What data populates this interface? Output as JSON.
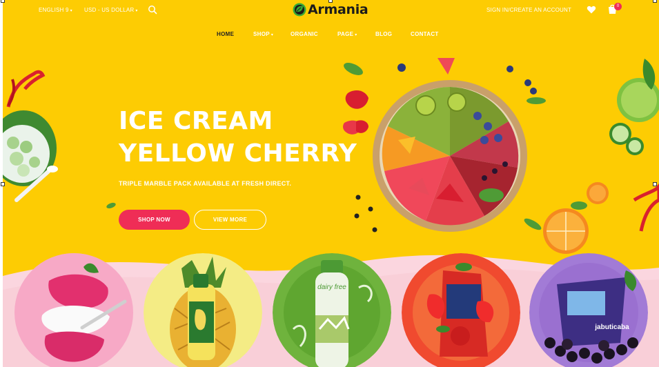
{
  "topbar": {
    "language": "ENGLISH 9",
    "currency": "USD - US DOLLAR",
    "account": "SIGN IN/CREATE AN ACCOUNT",
    "cart_count": "0"
  },
  "logo": {
    "text": "Armania"
  },
  "nav": {
    "items": [
      {
        "label": "HOME",
        "active": true,
        "has_caret": false
      },
      {
        "label": "SHOP",
        "active": false,
        "has_caret": true
      },
      {
        "label": "ORGANIC",
        "active": false,
        "has_caret": false
      },
      {
        "label": "PAGE",
        "active": false,
        "has_caret": true
      },
      {
        "label": "BLOG",
        "active": false,
        "has_caret": false
      },
      {
        "label": "CONTACT",
        "active": false,
        "has_caret": false
      }
    ]
  },
  "hero": {
    "title_line1": "ICE CREAM",
    "title_line2": "YELLOW CHERRY",
    "subtitle": "TRIPLE MARBLE PACK AVAILABLE AT FRESH DIRECT.",
    "primary_button": "SHOP NOW",
    "secondary_button": "VIEW MORE"
  },
  "product_labels": {
    "dairy": "dairy free",
    "jabuticaba": "jabuticaba"
  },
  "colors": {
    "background": "#fdcc03",
    "accent": "#ef2d56",
    "wave": "#fbd6df",
    "logo_green": "#3aa935"
  },
  "icons": [
    "search-icon",
    "heart-icon",
    "cart-icon",
    "chevron-down-icon",
    "leaf-logo-icon"
  ]
}
